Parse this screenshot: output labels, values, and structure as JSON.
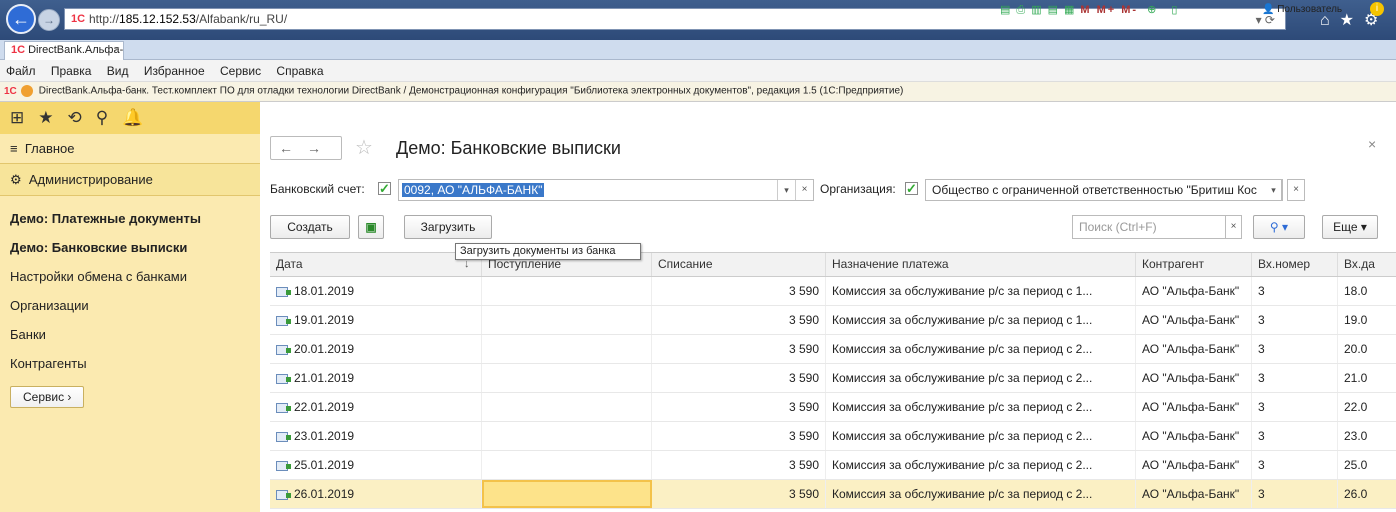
{
  "browser": {
    "url_prefix": "http://",
    "url_host": "185.12.152.53",
    "url_path": "/Alfabank/ru_RU/",
    "tab_title": "DirectBank.Альфа-банк. Те...",
    "menu": [
      "Файл",
      "Правка",
      "Вид",
      "Избранное",
      "Сервис",
      "Справка"
    ],
    "favbar_text": "DirectBank.Альфа-банк. Тест.комплект ПО для отладки технологии DirectBank / Демонстрационная конфигурация \"Библиотека электронных документов\", редакция 1.5  (1С:Предприятие)",
    "favbar_tools": "M M+ M-",
    "user": "Пользователь"
  },
  "sidebar": {
    "main": "Главное",
    "admin": "Администрирование",
    "items": [
      {
        "label": "Демо: Платежные документы",
        "bold": true
      },
      {
        "label": "Демо: Банковские выписки",
        "bold": true
      },
      {
        "label": "Настройки обмена с банками",
        "bold": false
      },
      {
        "label": "Организации",
        "bold": false
      },
      {
        "label": "Банки",
        "bold": false
      },
      {
        "label": "Контрагенты",
        "bold": false
      }
    ],
    "service_button": "Сервис ›"
  },
  "form": {
    "title": "Демо: Банковские выписки",
    "account_label": "Банковский счет:",
    "account_value": "0092, АО \"АЛЬФА-БАНК\"",
    "org_label": "Организация:",
    "org_value": "Общество с ограниченной ответственностью \"Бритиш Кос",
    "create": "Создать",
    "load": "Загрузить",
    "tooltip": "Загрузить документы из банка",
    "search_placeholder": "Поиск (Ctrl+F)",
    "more": "Еще ▾"
  },
  "table": {
    "columns": [
      "Дата",
      "Поступление",
      "Списание",
      "Назначение платежа",
      "Контрагент",
      "Вх.номер",
      "Вх.да"
    ],
    "rows": [
      {
        "date": "18.01.2019",
        "in": "",
        "out": "3 590",
        "purpose": "Комиссия за обслуживание р/с за период с 1...",
        "contractor": "АО \"Альфа-Банк\"",
        "num": "3",
        "indate": "18.0"
      },
      {
        "date": "19.01.2019",
        "in": "",
        "out": "3 590",
        "purpose": "Комиссия за обслуживание р/с за период с 1...",
        "contractor": "АО \"Альфа-Банк\"",
        "num": "3",
        "indate": "19.0"
      },
      {
        "date": "20.01.2019",
        "in": "",
        "out": "3 590",
        "purpose": "Комиссия за обслуживание р/с за период с 2...",
        "contractor": "АО \"Альфа-Банк\"",
        "num": "3",
        "indate": "20.0"
      },
      {
        "date": "21.01.2019",
        "in": "",
        "out": "3 590",
        "purpose": "Комиссия за обслуживание р/с за период с 2...",
        "contractor": "АО \"Альфа-Банк\"",
        "num": "3",
        "indate": "21.0"
      },
      {
        "date": "22.01.2019",
        "in": "",
        "out": "3 590",
        "purpose": "Комиссия за обслуживание р/с за период с 2...",
        "contractor": "АО \"Альфа-Банк\"",
        "num": "3",
        "indate": "22.0"
      },
      {
        "date": "23.01.2019",
        "in": "",
        "out": "3 590",
        "purpose": "Комиссия за обслуживание р/с за период с 2...",
        "contractor": "АО \"Альфа-Банк\"",
        "num": "3",
        "indate": "23.0"
      },
      {
        "date": "25.01.2019",
        "in": "",
        "out": "3 590",
        "purpose": "Комиссия за обслуживание р/с за период с 2...",
        "contractor": "АО \"Альфа-Банк\"",
        "num": "3",
        "indate": "25.0"
      },
      {
        "date": "26.01.2019",
        "in": "",
        "out": "3 590",
        "purpose": "Комиссия за обслуживание р/с за период с 2...",
        "contractor": "АО \"Альфа-Банк\"",
        "num": "3",
        "indate": "26.0",
        "selected": true
      }
    ]
  }
}
